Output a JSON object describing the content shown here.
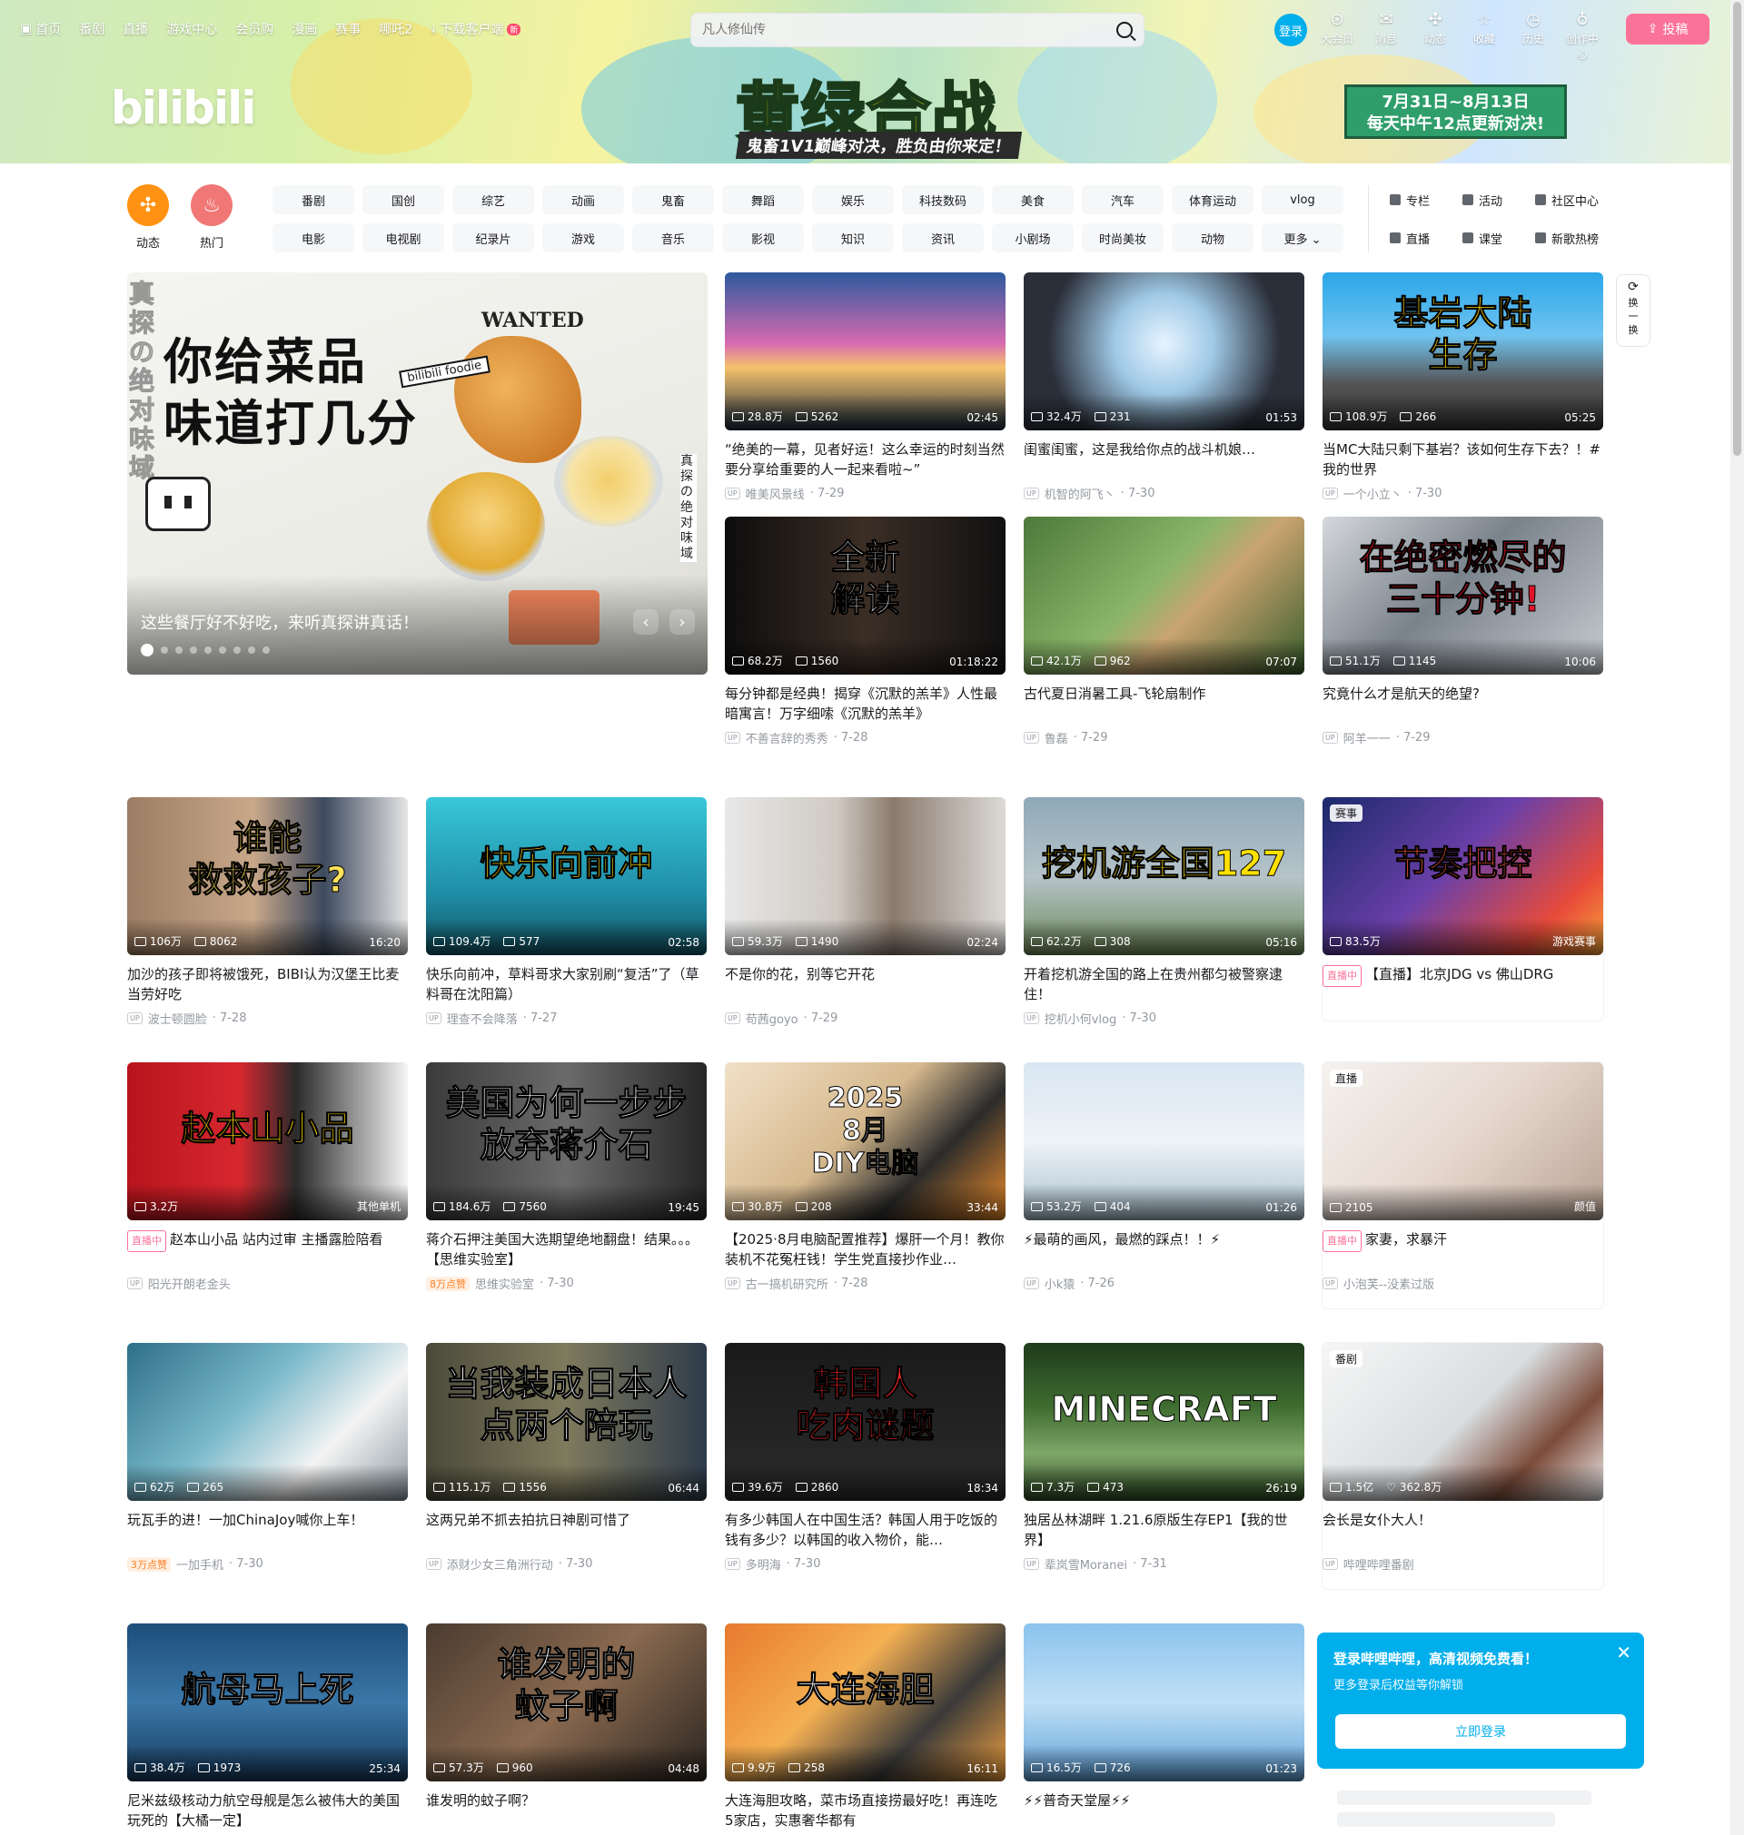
{
  "nav": {
    "left": [
      "首页",
      "番剧",
      "直播",
      "游戏中心",
      "会员购",
      "漫画",
      "赛事",
      "哪吒2",
      "下载客户端"
    ],
    "new_badge": "新",
    "search_placeholder": "凡人修仙传",
    "login": "登录",
    "right": [
      {
        "icon": "big-member-icon",
        "label": "大会员",
        "glyph": "⊛"
      },
      {
        "icon": "message-icon",
        "label": "消息",
        "glyph": "✉"
      },
      {
        "icon": "dynamic-icon",
        "label": "动态",
        "glyph": "✣"
      },
      {
        "icon": "favorite-icon",
        "label": "收藏",
        "glyph": "☆"
      },
      {
        "icon": "history-icon",
        "label": "历史",
        "glyph": "◷"
      },
      {
        "icon": "creator-icon",
        "label": "创作中心",
        "glyph": "♁"
      }
    ],
    "upload": "投稿"
  },
  "banner": {
    "logo": "bilibili",
    "title": "黄绿合战",
    "subtitle": "鬼畜1V1巅峰对决，胜负由你来定！",
    "date_line1": "7月31日~8月13日",
    "date_line2": "每天中午12点更新对决!"
  },
  "channels": {
    "icons": [
      {
        "label": "动态",
        "icon": "dynamic-icon"
      },
      {
        "label": "热门",
        "icon": "hot-icon"
      }
    ],
    "grid": [
      "番剧",
      "国创",
      "综艺",
      "动画",
      "鬼畜",
      "舞蹈",
      "娱乐",
      "科技数码",
      "美食",
      "汽车",
      "体育运动",
      "vlog",
      "电影",
      "电视剧",
      "纪录片",
      "游戏",
      "音乐",
      "影视",
      "知识",
      "资讯",
      "小剧场",
      "时尚美妆",
      "动物",
      "更多 ⌄"
    ],
    "extra": [
      "专栏",
      "活动",
      "社区中心",
      "直播",
      "课堂",
      "新歌热榜"
    ]
  },
  "carousel": {
    "headline_line1": "你给菜品",
    "headline_line2": "味道打几分",
    "tag": "bilibili foodie",
    "wanted": "WANTED",
    "vertical_left": "真探の绝对味域",
    "vertical_right": "真探の绝对味域",
    "title": "这些餐厅好不好吃，来听真探讲真话！",
    "prev": "‹",
    "next": "›"
  },
  "refresh": "换一换",
  "cards": [
    {
      "title": "“绝美的一幕，见者好运！这么幸运的时刻当然要分享给重要的人一起来看啦~”",
      "views": "28.8万",
      "danmaku": "5262",
      "duration": "02:45",
      "author": "唯美风景线",
      "date": "7-29",
      "bg": "linear-gradient(180deg,#2d5a9e 0%,#d86ab0 45%,#f5c26b 60%,#1e2d40 100%)"
    },
    {
      "title": "闺蜜闺蜜，这是我给你点的战斗机娘…",
      "views": "32.4万",
      "danmaku": "231",
      "duration": "01:53",
      "author": "机智的阿飞丶",
      "date": "7-30",
      "bg": "radial-gradient(circle at 50% 45%,#e8f4ff 0%,#9fc9e6 30%,#2b2f3a 70%)"
    },
    {
      "title": "当MC大陆只剩下基岩？该如何生存下去？！#我的世界",
      "views": "108.9万",
      "danmaku": "266",
      "duration": "05:25",
      "author": "一个小立丶",
      "date": "7-30",
      "bg": "linear-gradient(180deg,#2aa6e8 0%,#6fc3f0 40%,#555 70%,#333 100%)",
      "overlay": "基岩大陆 生存",
      "overlay_color": "#ffd400"
    },
    {
      "title": "每分钟都是经典！揭穿《沉默的羔羊》人性最暗寓言！万字细嗦《沉默的羔羊》",
      "views": "68.2万",
      "danmaku": "1560",
      "duration": "01:18:22",
      "author": "不善言辞的秀秀",
      "date": "7-28",
      "bg": "linear-gradient(90deg,#0d0d0d 0%,#3b2e25 50%,#111 100%)",
      "overlay": "全新 解读",
      "overlay_color": "#ffffff"
    },
    {
      "title": "古代夏日消暑工具-飞轮扇制作",
      "views": "42.1万",
      "danmaku": "962",
      "duration": "07:07",
      "author": "鲁磊",
      "date": "7-29",
      "bg": "linear-gradient(135deg,#4d7a3a 0%,#8bb56a 45%,#c9a470 60%,#385c2c 100%)"
    },
    {
      "title": "究竟什么才是航天的绝望?",
      "views": "51.1万",
      "danmaku": "1145",
      "duration": "10:06",
      "author": "阿羊一一",
      "date": "7-29",
      "bg": "linear-gradient(135deg,#d5d8dc 0%,#7a828b 45%,#c7ccd1 100%)",
      "overlay": "在绝密燃尽的 三十分钟!",
      "overlay_color": "#e0142b"
    },
    {
      "title": "加沙的孩子即将被饿死，BIBI认为汉堡王比麦当劳好吃",
      "views": "106万",
      "danmaku": "8062",
      "duration": "16:20",
      "author": "波士顿圆脸",
      "date": "7-28",
      "bg": "linear-gradient(90deg,#9c7d63 0%,#c9a88a 45%,#3d4a5e 70%,#e5e5e5 100%)",
      "overlay": "谁能 救救孩子?",
      "overlay_color": "#ffe15a"
    },
    {
      "title": "快乐向前冲，草料哥求大家别刷“复活”了（草料哥在沈阳篇）",
      "views": "109.4万",
      "danmaku": "577",
      "duration": "02:58",
      "author": "理查不会降落",
      "date": "7-27",
      "bg": "linear-gradient(180deg,#38c7d9 0%,#1f8fa8 60%,#145566 100%)",
      "overlay": "快乐向前冲",
      "overlay_color": "#ffe100"
    },
    {
      "title": "不是你的花，别等它开花",
      "views": "59.3万",
      "danmaku": "1490",
      "duration": "02:24",
      "author": "苟茜goyo",
      "date": "7-29",
      "bg": "linear-gradient(90deg,#e8e8e8 0%,#cfc9c2 40%,#8b7b6e 60%,#dcdad7 100%)"
    },
    {
      "title": "开着挖机游全国的路上在贵州都匀被警察逮住！",
      "views": "62.2万",
      "danmaku": "308",
      "duration": "05:16",
      "author": "挖机小何vlog",
      "date": "7-30",
      "bg": "linear-gradient(180deg,#8fa9b8 0%,#b6c3c9 50%,#6f8a5a 100%)",
      "overlay": "挖机游全国127",
      "overlay_color": "#ffe100"
    },
    {
      "title": "【直播】北京JDG vs 佛山DRG",
      "views": "83.5万",
      "badge": "赛事",
      "right_tag": "游戏赛事",
      "live": true,
      "bg": "linear-gradient(135deg,#1b2a6b 0%,#6a3fa8 45%,#e84a3a 80%,#f8a53a 100%)",
      "overlay": "节奏把控",
      "overlay_color": "#ff5a3a",
      "boxed": true
    },
    {
      "title": "赵本山小品 站内过审 主播露脸陪看",
      "views": "3.2万",
      "author": "阳光开朗老金头",
      "right_tag": "其他单机",
      "live": true,
      "bg": "linear-gradient(90deg,#b8141d 0%,#d7272f 40%,#2b2b2b 60%,#f5f5f5 100%)",
      "overlay": "赵本山小品",
      "overlay_color": "#ffd400"
    },
    {
      "title": "蒋介石押注美国大选期望绝地翻盘！结果。。。【思维实验室】",
      "views": "184.6万",
      "danmaku": "7560",
      "duration": "19:45",
      "author": "思维实验室",
      "date": "7-30",
      "hot": "8万点赞",
      "bg": "linear-gradient(90deg,#3b3b3b 0%,#6b6b6b 50%,#262626 100%)",
      "overlay": "美国为何一步步 放弃蒋介石",
      "overlay_color": "#ffffff"
    },
    {
      "title": "【2025·8月电脑配置推荐】爆肝一个月！教你装机不花冤枉钱！学生党直接抄作业…",
      "views": "30.8万",
      "danmaku": "208",
      "duration": "33:44",
      "author": "古一搞机研究所",
      "date": "7-28",
      "bg": "linear-gradient(135deg,#f2e1c8 0%,#d6b98e 45%,#2b2b2b 70%,#e98b2b 100%)",
      "overlay": "2025 8月 DIY电脑",
      "overlay_color": "#ffffff"
    },
    {
      "title": "⚡最萌的画风，最燃的踩点！！⚡",
      "views": "53.2万",
      "danmaku": "404",
      "duration": "01:26",
      "author": "小k猿",
      "date": "7-26",
      "bg": "linear-gradient(180deg,#d9e6f2 0%,#eef3f7 50%,#a9c0cf 100%)"
    },
    {
      "title": "家妻，求暴汗",
      "views": "2105",
      "badge": "直播",
      "right_tag": "颜值",
      "author": "小泡芙--没素过版",
      "live": true,
      "bg": "linear-gradient(135deg,#f5f2ef 0%,#e6d8cf 50%,#b9a394 100%)",
      "boxed": true
    },
    {
      "title": "玩瓦手的进！一加ChinaJoy喊你上车！",
      "views": "62万",
      "danmaku": "265",
      "author": "一加手机",
      "date": "7-30",
      "hot": "3万点赞",
      "bg": "linear-gradient(135deg,#2e6f88 0%,#76b7c9 40%,#f3f3f3 70%,#8e9aa3 100%)"
    },
    {
      "title": "这两兄弟不抓去拍抗日神剧可惜了",
      "views": "115.1万",
      "danmaku": "1556",
      "duration": "06:44",
      "author": "添财少女三角洲行动",
      "date": "7-30",
      "bg": "linear-gradient(90deg,#4b4a3a 0%,#7e7a5d 50%,#2e3b4a 100%)",
      "overlay": "当我装成日本人 点两个陪玩",
      "overlay_color": "#ffffff"
    },
    {
      "title": "有多少韩国人在中国生活？韩国人用于吃饭的钱有多少？以韩国的收入物价，能…",
      "views": "39.6万",
      "danmaku": "2860",
      "duration": "18:34",
      "author": "多明海",
      "date": "7-30",
      "bg": "linear-gradient(180deg,#1a1a1a 0%,#2b2b2b 100%)",
      "overlay": "韩国人 吃肉谜题",
      "overlay_color": "#ff2a2a"
    },
    {
      "title": "独居丛林湖畔 1.21.6原版生存EP1【我的世界】",
      "views": "7.3万",
      "danmaku": "473",
      "duration": "26:19",
      "author": "辈岚雪Moranei",
      "date": "7-31",
      "bg": "linear-gradient(180deg,#1f3b1c 0%,#3e6b2f 40%,#7fa76a 70%,#2d4a24 100%)",
      "overlay": "MINECRAFT",
      "overlay_color": "#ffffff"
    },
    {
      "title": "会长是女仆大人！",
      "views": "1.5亿",
      "likes": "362.8万",
      "badge": "番剧",
      "author": "哔哩哔哩番剧",
      "bg": "linear-gradient(135deg,#f6f6f6 0%,#d9dde0 50%,#7c4b3a 75%,#f3f3f3 100%)",
      "boxed": true
    },
    {
      "title": "尼米兹级核动力航空母舰是怎么被伟大的美国玩死的【大橘一定】",
      "views": "38.4万",
      "danmaku": "1973",
      "duration": "25:34",
      "bg": "linear-gradient(180deg,#1e4e7a 0%,#3a77a8 50%,#173a5c 100%)",
      "overlay": "航母马上死",
      "overlay_color": "#ffffff"
    },
    {
      "title": "谁发明的蚊子啊？",
      "views": "57.3万",
      "danmaku": "960",
      "duration": "04:48",
      "bg": "linear-gradient(135deg,#4a3b30 0%,#8a6a50 50%,#2b2520 100%)",
      "overlay": "谁发明的 蚊子啊",
      "overlay_color": "#ffffff"
    },
    {
      "title": "大连海胆攻略，菜市场直接捞最好吃！再连吃5家店，实惠奢华都有",
      "views": "9.9万",
      "danmaku": "258",
      "duration": "16:11",
      "bg": "linear-gradient(135deg,#e87a2f 0%,#f5b052 40%,#3a3a3a 70%,#f0a040 100%)",
      "overlay": "大连海胆",
      "overlay_color": "#ffffff"
    },
    {
      "title": "⚡⚡普奇天堂屋⚡⚡",
      "views": "16.5万",
      "danmaku": "726",
      "duration": "01:23",
      "bg": "linear-gradient(180deg,#8cc3ee 0%,#bfe0f5 50%,#5ea0d8 100%)"
    }
  ],
  "login_popup": {
    "title": "登录哔哩哔哩，高清视频免费看！",
    "subtitle": "更多登录后权益等你解锁",
    "button": "立即登录",
    "close": "✕"
  },
  "live_label": "直播中"
}
